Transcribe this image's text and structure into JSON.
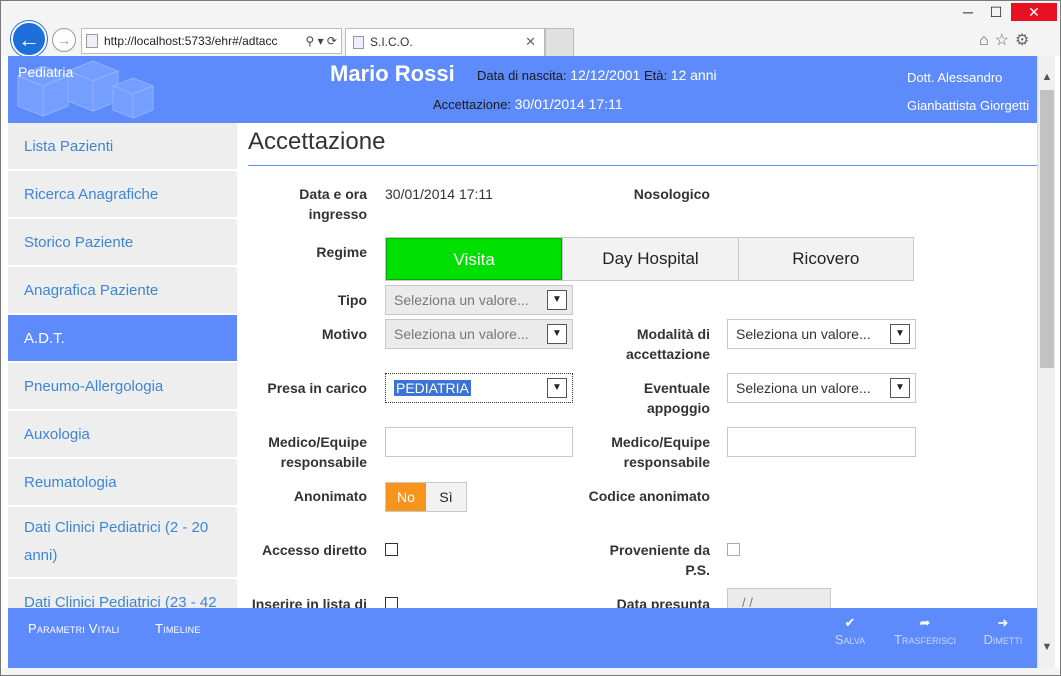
{
  "browser": {
    "url": "http://localhost:5733/ehr#/adtacc",
    "tab_title": "S.I.C.O.",
    "window_controls": {
      "minimize": "─",
      "maximize": "☐",
      "close": "✕"
    },
    "back_icon": "←",
    "forward_icon": "→",
    "tab_close_icon": "✕",
    "address_tools": "⚲ ▾ ⟳",
    "toolbar_icons": "⌂☆⚙"
  },
  "header": {
    "department": "Pediatria",
    "patient_name": "Mario Rossi",
    "birth_label": "Data di nascita:",
    "birth_value": "12/12/2001",
    "age_label": "Età:",
    "age_value": "12 anni",
    "acceptance_label": "Accettazione:",
    "acceptance_value": "30/01/2014 17:11",
    "doctor_line1": "Dott. Alessandro",
    "doctor_line2": "Gianbattista Giorgetti"
  },
  "sidebar": {
    "items": [
      {
        "label": "Lista Pazienti",
        "active": false
      },
      {
        "label": "Ricerca Anagrafiche",
        "active": false
      },
      {
        "label": "Storico Paziente",
        "active": false
      },
      {
        "label": "Anagrafica Paziente",
        "active": false
      },
      {
        "label": "A.D.T.",
        "active": true
      },
      {
        "label": "Pneumo-Allergologia",
        "active": false
      },
      {
        "label": "Auxologia",
        "active": false
      },
      {
        "label": "Reumatologia",
        "active": false
      },
      {
        "label": "Dati Clinici Pediatrici (2 - 20 anni)",
        "active": false
      },
      {
        "label": "Dati Clinici Pediatrici (23 - 42",
        "active": false
      }
    ]
  },
  "form": {
    "title": "Accettazione",
    "data_ingresso_label": "Data e ora ingresso",
    "data_ingresso_value": "30/01/2014 17:11",
    "nosologico_label": "Nosologico",
    "regime_label": "Regime",
    "regime_options": [
      "Visita",
      "Day Hospital",
      "Ricovero"
    ],
    "regime_selected": "Visita",
    "tipo_label": "Tipo",
    "tipo_value": "Seleziona un valore...",
    "motivo_label": "Motivo",
    "motivo_value": "Seleziona un valore...",
    "modalita_label": "Modalità di accettazione",
    "modalita_value": "Seleziona un valore...",
    "presa_label": "Presa in carico",
    "presa_value": "PEDIATRIA",
    "appoggio_label": "Eventuale appoggio",
    "appoggio_value": "Seleziona un valore...",
    "medico1_label": "Medico/Equipe responsabile",
    "medico1_value": "",
    "medico2_label": "Medico/Equipe responsabile",
    "medico2_value": "",
    "anonimato_label": "Anonimato",
    "anonimato_options": [
      "No",
      "Sì"
    ],
    "anonimato_selected": "No",
    "codice_anonimato_label": "Codice anonimato",
    "accesso_label": "Accesso diretto",
    "ps_label": "Proveniente da P.S.",
    "lista_label": "Inserire in lista di",
    "data_presunta_label": "Data presunta",
    "data_presunta_value": "/  /"
  },
  "footer": {
    "links": [
      "Parametri Vitali",
      "Timeline"
    ],
    "actions": [
      {
        "label": "Salva",
        "icon": "✔"
      },
      {
        "label": "Trasferisci",
        "icon": "➦"
      },
      {
        "label": "Dimetti",
        "icon": "➜"
      }
    ]
  },
  "colors": {
    "accent": "#5e8bfb",
    "visita_on": "#00e000",
    "anonimato_on": "#f7941d",
    "link": "#3d86d6"
  }
}
